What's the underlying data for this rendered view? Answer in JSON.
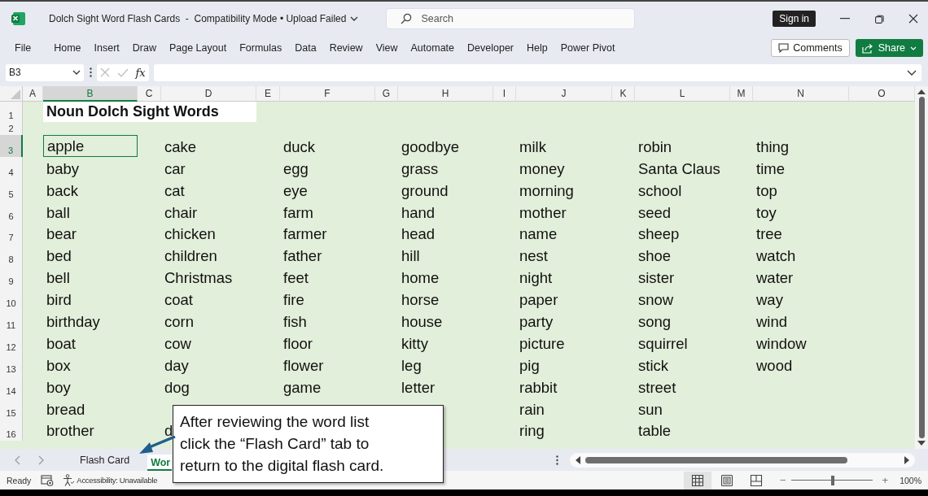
{
  "window": {
    "title": "Dolch Sight Word Flash Cards  -  Compatibility Mode • Upload Failed",
    "search_placeholder": "Search",
    "sign_in": "Sign in"
  },
  "ribbon": {
    "tabs": [
      "File",
      "Home",
      "Insert",
      "Draw",
      "Page Layout",
      "Formulas",
      "Data",
      "Review",
      "View",
      "Automate",
      "Developer",
      "Help",
      "Power Pivot"
    ],
    "comments": "Comments",
    "share": "Share"
  },
  "formula_bar": {
    "name_box": "B3",
    "fx": "fx"
  },
  "sheet": {
    "columns": [
      {
        "label": "A",
        "selected": false
      },
      {
        "label": "B",
        "selected": true
      },
      {
        "label": "C",
        "selected": false
      },
      {
        "label": "D",
        "selected": false
      },
      {
        "label": "E",
        "selected": false
      },
      {
        "label": "F",
        "selected": false
      },
      {
        "label": "G",
        "selected": false
      },
      {
        "label": "H",
        "selected": false
      },
      {
        "label": "I",
        "selected": false
      },
      {
        "label": "J",
        "selected": false
      },
      {
        "label": "K",
        "selected": false
      },
      {
        "label": "L",
        "selected": false
      },
      {
        "label": "M",
        "selected": false
      },
      {
        "label": "N",
        "selected": false
      },
      {
        "label": "O",
        "selected": false
      }
    ],
    "rows": [
      {
        "number": "1",
        "selected": false,
        "title": "Noun Dolch Sight Words"
      },
      {
        "number": "2",
        "selected": false
      },
      {
        "number": "3",
        "selected": true,
        "cells": [
          "apple",
          "cake",
          "duck",
          "goodbye",
          "milk",
          "robin",
          "thing"
        ]
      },
      {
        "number": "4",
        "selected": false,
        "cells": [
          "baby",
          "car",
          "egg",
          "grass",
          "money",
          "Santa Claus",
          "time"
        ]
      },
      {
        "number": "5",
        "selected": false,
        "cells": [
          "back",
          "cat",
          "eye",
          "ground",
          "morning",
          "school",
          "top"
        ]
      },
      {
        "number": "6",
        "selected": false,
        "cells": [
          "ball",
          "chair",
          "farm",
          "hand",
          "mother",
          "seed",
          "toy"
        ]
      },
      {
        "number": "7",
        "selected": false,
        "cells": [
          "bear",
          "chicken",
          "farmer",
          "head",
          "name",
          "sheep",
          "tree"
        ]
      },
      {
        "number": "8",
        "selected": false,
        "cells": [
          "bed",
          "children",
          "father",
          "hill",
          "nest",
          "shoe",
          "watch"
        ]
      },
      {
        "number": "9",
        "selected": false,
        "cells": [
          "bell",
          "Christmas",
          "feet",
          "home",
          "night",
          "sister",
          "water"
        ]
      },
      {
        "number": "10",
        "selected": false,
        "cells": [
          "bird",
          "coat",
          "fire",
          "horse",
          "paper",
          "snow",
          "way"
        ]
      },
      {
        "number": "11",
        "selected": false,
        "cells": [
          "birthday",
          "corn",
          "fish",
          "house",
          "party",
          "song",
          "wind"
        ]
      },
      {
        "number": "12",
        "selected": false,
        "cells": [
          "boat",
          "cow",
          "floor",
          "kitty",
          "picture",
          "squirrel",
          "window"
        ]
      },
      {
        "number": "13",
        "selected": false,
        "cells": [
          "box",
          "day",
          "flower",
          "leg",
          "pig",
          "stick",
          "wood"
        ]
      },
      {
        "number": "14",
        "selected": false,
        "cells": [
          "boy",
          "dog",
          "game",
          "letter",
          "rabbit",
          "street",
          null
        ]
      },
      {
        "number": "15",
        "selected": false,
        "cells": [
          "bread",
          null,
          null,
          null,
          "rain",
          "sun",
          null
        ]
      },
      {
        "number": "16",
        "selected": false,
        "cells": [
          "brother",
          "d",
          null,
          null,
          "ring",
          "table",
          null
        ]
      }
    ]
  },
  "sheet_tabs": [
    {
      "label": "Flash Card",
      "selected": false
    },
    {
      "label": "Wor",
      "selected": true
    }
  ],
  "callout": {
    "text": "After reviewing the word list\nclick the “Flash Card” tab to\nreturn to the digital flash card."
  },
  "status_bar": {
    "ready": "Ready",
    "accessibility": "Accessibility: Unavailable",
    "views": [
      {
        "kind": "normal",
        "selected": true
      },
      {
        "kind": "page-layout",
        "selected": false
      },
      {
        "kind": "page-break",
        "selected": false
      }
    ],
    "zoom_minus": "−",
    "zoom_plus": "+",
    "zoom": {
      "level": 0.51
    },
    "zoom_label": "100%"
  }
}
